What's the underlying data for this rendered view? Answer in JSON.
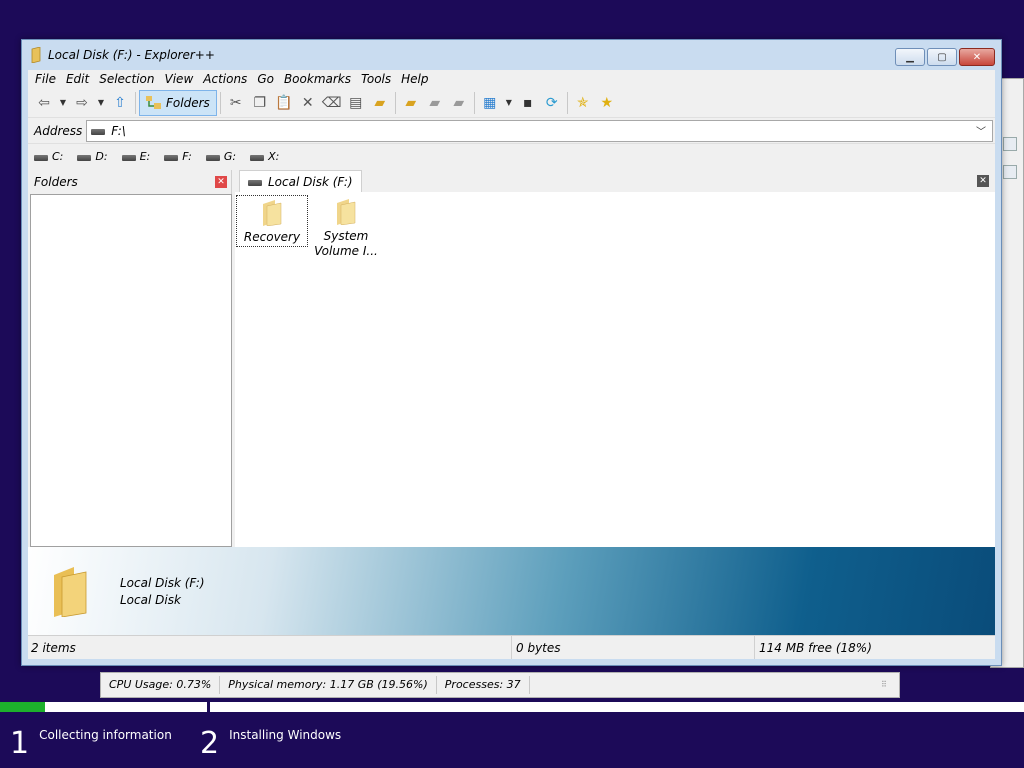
{
  "window": {
    "title": "Local Disk (F:) - Explorer++",
    "controls": {
      "minimize": "▁",
      "maximize": "▢",
      "close": "✕"
    }
  },
  "menu": [
    "File",
    "Edit",
    "Selection",
    "View",
    "Actions",
    "Go",
    "Bookmarks",
    "Tools",
    "Help"
  ],
  "toolbar": {
    "folders_label": "Folders"
  },
  "address": {
    "label": "Address",
    "value": "F:\\"
  },
  "drives": [
    "C:",
    "D:",
    "E:",
    "F:",
    "G:",
    "X:"
  ],
  "folders_pane": {
    "title": "Folders"
  },
  "tab": {
    "label": "Local Disk (F:)"
  },
  "files": [
    {
      "name": "Recovery"
    },
    {
      "name": "System\nVolume I..."
    }
  ],
  "info": {
    "line1": "Local Disk (F:)",
    "line2": "Local Disk"
  },
  "status": {
    "items": "2 items",
    "size": "0 bytes",
    "free": "114 MB free (18%)"
  },
  "taskmon": {
    "cpu": "CPU Usage: 0.73%",
    "memory": "Physical memory: 1.17 GB (19.56%)",
    "processes": "Processes: 37"
  },
  "setup": {
    "progress_fraction": 0.044,
    "steps": [
      {
        "num": "1",
        "label": "Collecting information"
      },
      {
        "num": "2",
        "label": "Installing Windows"
      }
    ]
  },
  "colors": {
    "desktop": "#1c0a58",
    "progress": "#1db02c",
    "accent": "#cce4f7"
  }
}
